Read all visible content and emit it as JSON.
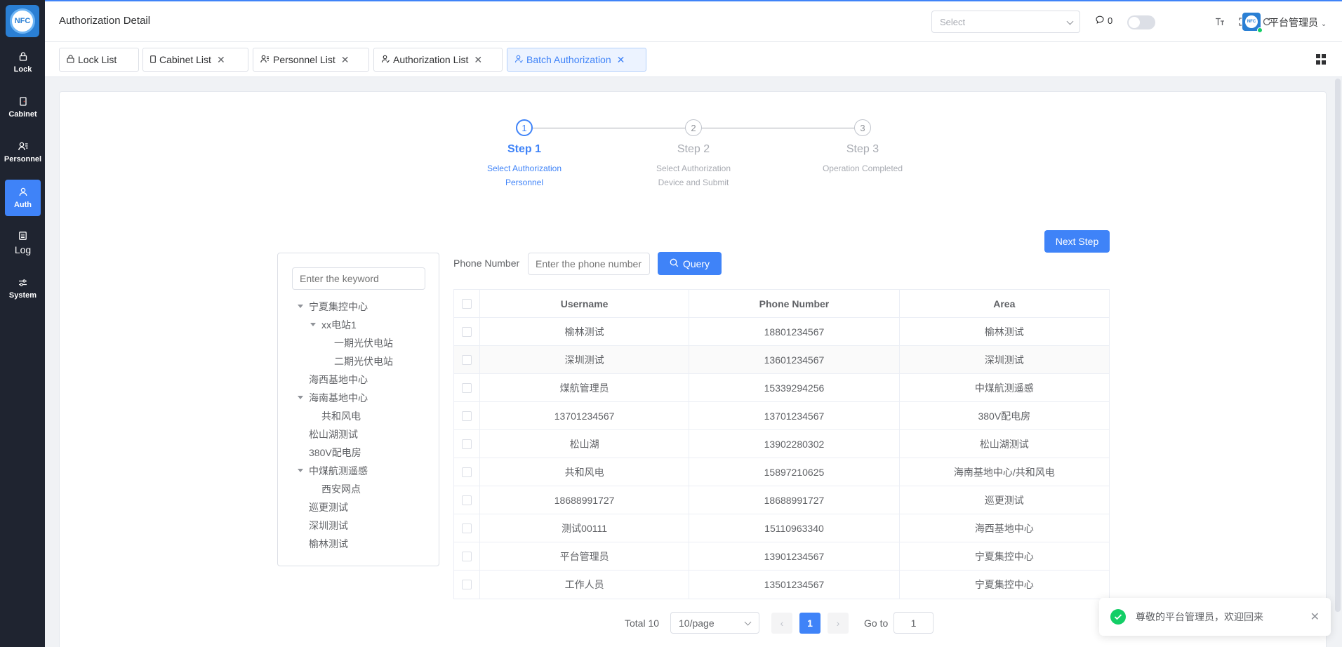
{
  "app": {
    "logo_text": "NFC"
  },
  "sidebar": {
    "items": [
      {
        "label": "Lock",
        "icon": "lock-icon"
      },
      {
        "label": "Cabinet",
        "icon": "cabinet-icon"
      },
      {
        "label": "Personnel",
        "icon": "personnel-icon"
      },
      {
        "label": "Auth",
        "icon": "auth-icon",
        "active": true
      },
      {
        "label": "Log",
        "icon": "log-icon"
      },
      {
        "label": "System",
        "icon": "system-icon"
      }
    ]
  },
  "header": {
    "title": "Authorization Detail",
    "select_placeholder": "Select",
    "message_count": "0",
    "user_name": "平台管理员"
  },
  "tabs": [
    {
      "label": "Lock List",
      "closable": false
    },
    {
      "label": "Cabinet List",
      "closable": true
    },
    {
      "label": "Personnel List",
      "closable": true
    },
    {
      "label": "Authorization List",
      "closable": true
    },
    {
      "label": "Batch Authorization",
      "closable": true,
      "active": true
    }
  ],
  "steps": [
    {
      "number": "1",
      "title": "Step 1",
      "desc_line1": "Select Authorization",
      "desc_line2": "Personnel"
    },
    {
      "number": "2",
      "title": "Step 2",
      "desc_line1": "Select Authorization",
      "desc_line2": "Device and Submit"
    },
    {
      "number": "3",
      "title": "Step 3",
      "desc_line1": "Operation Completed",
      "desc_line2": ""
    }
  ],
  "next_step_label": "Next Step",
  "tree": {
    "search_placeholder": "Enter the keyword",
    "nodes": [
      "宁夏集控中心",
      "xx电站1",
      "一期光伏电站",
      "二期光伏电站",
      "海西基地中心",
      "海南基地中心",
      "共和风电",
      "松山湖测试",
      "380V配电房",
      "中煤航测遥感",
      "西安网点",
      "巡更测试",
      "深圳测试",
      "榆林测试"
    ]
  },
  "filter": {
    "phone_label": "Phone Number",
    "phone_placeholder": "Enter the phone number",
    "query_label": "Query"
  },
  "table": {
    "columns": [
      "Username",
      "Phone Number",
      "Area"
    ],
    "rows": [
      [
        "榆林测试",
        "18801234567",
        "榆林测试"
      ],
      [
        "深圳测试",
        "13601234567",
        "深圳测试"
      ],
      [
        "煤航管理员",
        "15339294256",
        "中煤航测遥感"
      ],
      [
        "13701234567",
        "13701234567",
        "380V配电房"
      ],
      [
        "松山湖",
        "13902280302",
        "松山湖测试"
      ],
      [
        "共和风电",
        "15897210625",
        "海南基地中心/共和风电"
      ],
      [
        "18688991727",
        "18688991727",
        "巡更测试"
      ],
      [
        "测试00111",
        "15110963340",
        "海西基地中心"
      ],
      [
        "平台管理员",
        "13901234567",
        "宁夏集控中心"
      ],
      [
        "工作人员",
        "13501234567",
        "宁夏集控中心"
      ]
    ]
  },
  "pagination": {
    "total_label": "Total 10",
    "page_size": "10/page",
    "current_page": "1",
    "goto_label": "Go to",
    "goto_value": "1"
  },
  "toast": {
    "message": "尊敬的平台管理员，欢迎回来"
  },
  "colors": {
    "primary": "#3f83f8",
    "sidebar_bg": "#1f2430",
    "success": "#13ce66"
  }
}
